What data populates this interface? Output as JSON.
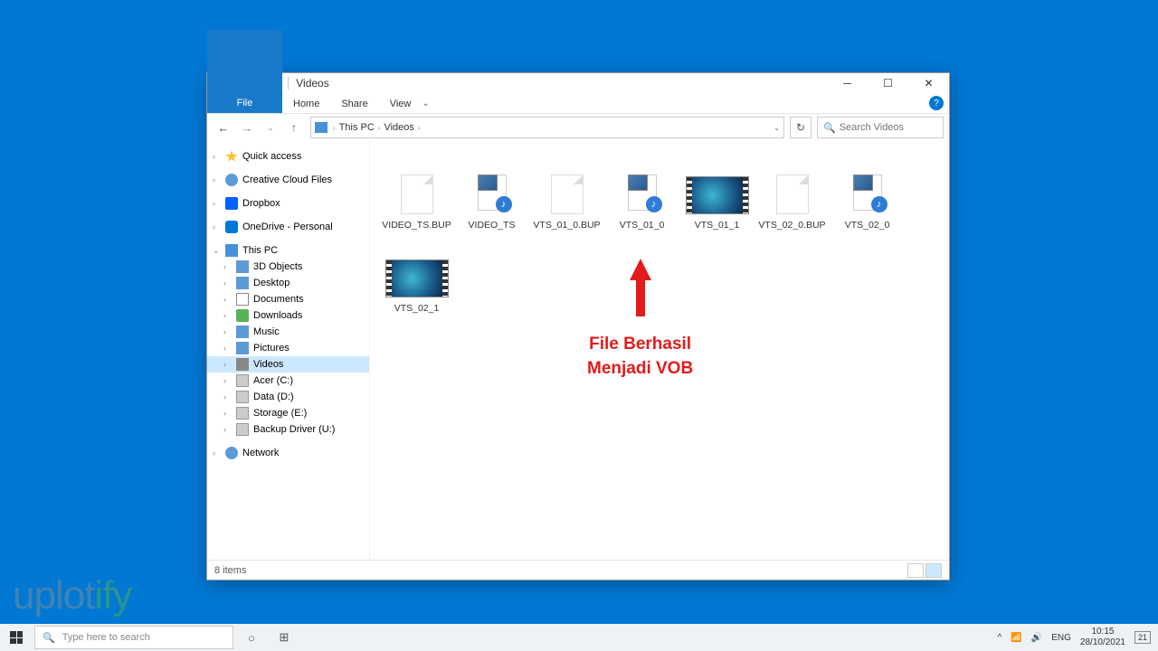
{
  "window": {
    "title": "Videos",
    "tabs": {
      "file": "File",
      "home": "Home",
      "share": "Share",
      "view": "View"
    }
  },
  "breadcrumb": {
    "root": "This PC",
    "folder": "Videos"
  },
  "search": {
    "placeholder": "Search Videos"
  },
  "sidebar": {
    "quick_access": "Quick access",
    "creative_cloud": "Creative Cloud Files",
    "dropbox": "Dropbox",
    "onedrive": "OneDrive - Personal",
    "this_pc": "This PC",
    "obj3d": "3D Objects",
    "desktop": "Desktop",
    "documents": "Documents",
    "downloads": "Downloads",
    "music": "Music",
    "pictures": "Pictures",
    "videos": "Videos",
    "acer": "Acer (C:)",
    "data": "Data (D:)",
    "storage": "Storage (E:)",
    "backup": "Backup Driver (U:)",
    "network": "Network"
  },
  "files": [
    {
      "name": "VIDEO_TS.BUP",
      "thumb": "blank"
    },
    {
      "name": "VIDEO_TS",
      "thumb": "audio"
    },
    {
      "name": "VTS_01_0.BUP",
      "thumb": "blank"
    },
    {
      "name": "VTS_01_0",
      "thumb": "audio"
    },
    {
      "name": "VTS_01_1",
      "thumb": "video"
    },
    {
      "name": "VTS_02_0.BUP",
      "thumb": "blank"
    },
    {
      "name": "VTS_02_0",
      "thumb": "audio"
    },
    {
      "name": "VTS_02_1",
      "thumb": "video"
    }
  ],
  "annotation": {
    "line1": "File Berhasil",
    "line2": "Menjadi VOB"
  },
  "status": {
    "count": "8 items"
  },
  "taskbar": {
    "search_placeholder": "Type here to search",
    "lang": "ENG",
    "time": "10:15",
    "date": "28/10/2021",
    "notif": "21"
  },
  "watermark": {
    "part1": "uplot",
    "part2": "ify"
  }
}
